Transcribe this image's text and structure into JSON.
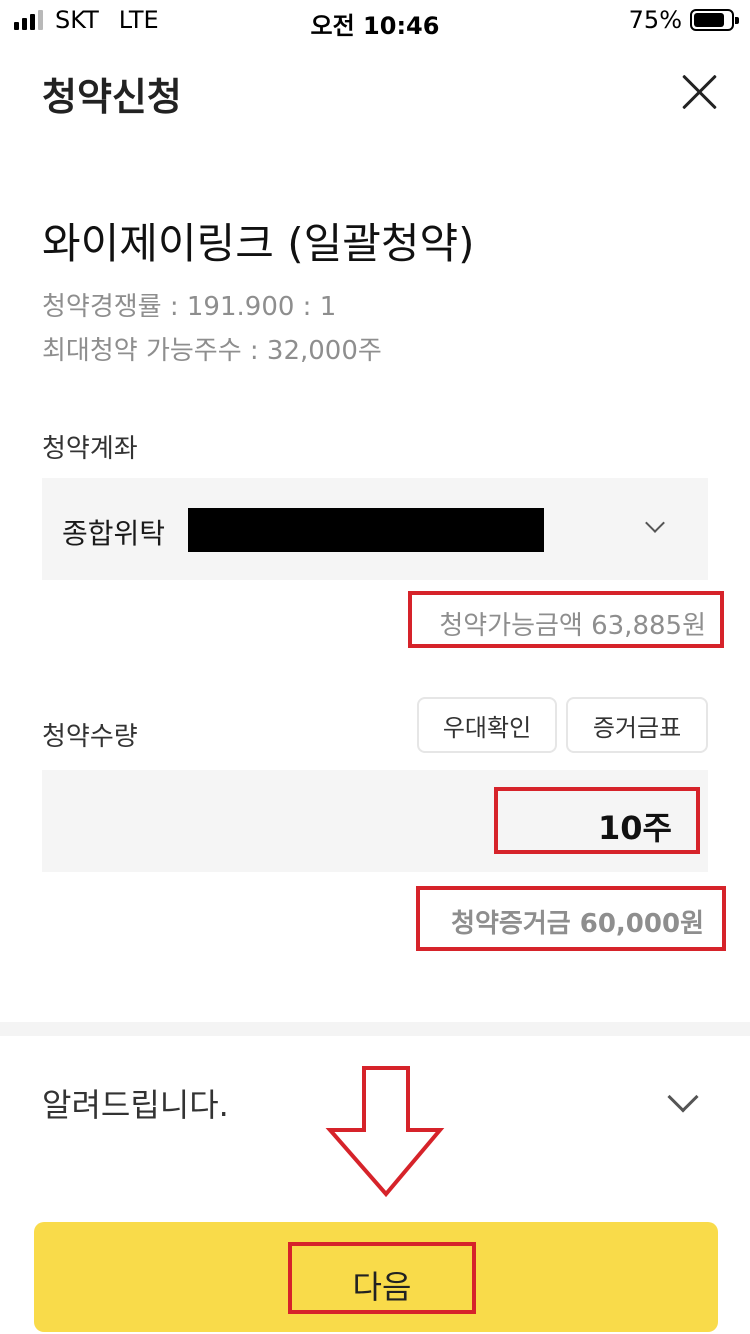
{
  "status_bar": {
    "carrier": "SKT",
    "network": "LTE",
    "time": "오전 10:46",
    "battery": "75%"
  },
  "header": {
    "title": "청약신청"
  },
  "stock": {
    "name": "와이제이링크 (일괄청약)",
    "competition": "청약경쟁률 : 191.900 : 1",
    "max_shares": "최대청약 가능주수 : 32,000주"
  },
  "account": {
    "label": "청약계좌",
    "type": "종합위탁",
    "available_amount": "청약가능금액 63,885원"
  },
  "quantity": {
    "label": "청약수량",
    "preference_button": "우대확인",
    "margin_table_button": "증거금표",
    "value": "10주",
    "deposit": "청약증거금 60,000원"
  },
  "notice": {
    "label": "알려드립니다."
  },
  "footer": {
    "next_label": "다음"
  },
  "colors": {
    "accent_yellow": "#f9db4a",
    "annotation_red": "#d6232a"
  }
}
